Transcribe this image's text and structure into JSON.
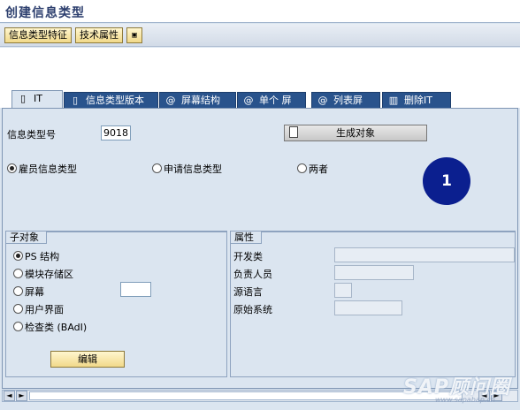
{
  "title": "创建信息类型",
  "toolbar": {
    "btn_infotype_features": "信息类型特征",
    "btn_technical_attributes": "技术属性",
    "icon_button": "▣"
  },
  "tabs": [
    {
      "label": "IT",
      "icon": "document-icon"
    },
    {
      "label": "信息类型版本",
      "icon": "document-icon"
    },
    {
      "label": "屏幕结构",
      "icon": "at-icon"
    },
    {
      "label": "单个 屏",
      "icon": "at-icon"
    },
    {
      "label": "列表屏",
      "icon": "at-icon"
    },
    {
      "label": "删除IT",
      "icon": "trash-icon"
    }
  ],
  "main": {
    "infotype_label": "信息类型号",
    "infotype_value": "9018",
    "generate_button": "生成对象",
    "radios": {
      "employee": "雇员信息类型",
      "applicant": "申请信息类型",
      "both": "两者"
    },
    "circle_number": "1"
  },
  "subobjects": {
    "header": "子对象",
    "options": [
      "PS 结构",
      "模块存储区",
      "屏幕",
      "用户界面",
      "检查类 (BAdI)"
    ],
    "edit_button": "编辑"
  },
  "attributes": {
    "header": "属性",
    "rows": [
      {
        "label": "开发类",
        "value": ""
      },
      {
        "label": "负责人员",
        "value": ""
      },
      {
        "label": "源语言",
        "value": ""
      },
      {
        "label": "原始系统",
        "value": ""
      }
    ]
  },
  "scrollbar": {
    "left_arrow": "◄",
    "right_arrow": "►"
  },
  "watermark": {
    "main": "SAP顾问圈",
    "sub": "www.sapabap.cn"
  }
}
